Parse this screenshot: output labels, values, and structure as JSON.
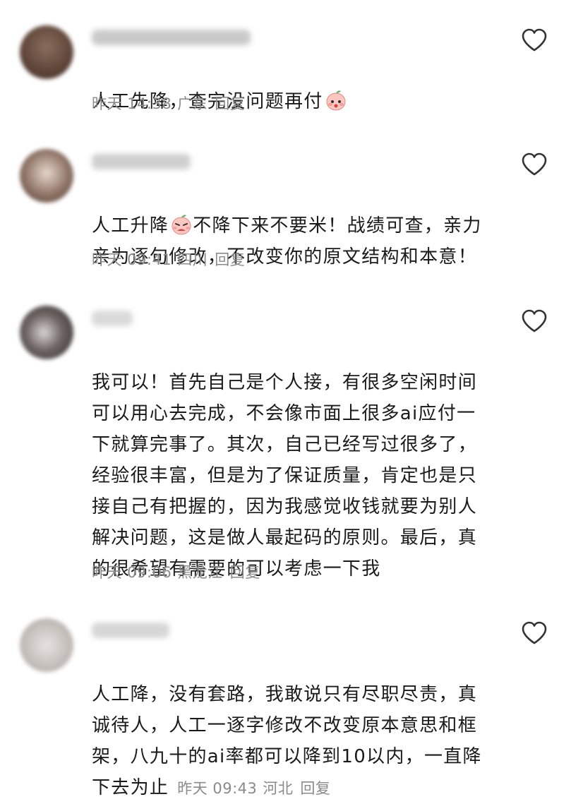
{
  "comments": [
    {
      "text": "人工先降，查完没问题再付",
      "emoji": "flushed-peach-emoji",
      "date": "昨天 14:38",
      "region": "广东",
      "reply": "回复",
      "avatar_color": "#6b5448"
    },
    {
      "text_a": "人工升降",
      "emoji": "angry-peach-emoji",
      "text_b": "不降下来不要米！战绩可查，亲力\n亲为逐句修改，不改变你的原文结构和本意！",
      "date": "昨天 09:41",
      "region": "四川",
      "reply": "回复",
      "avatar_color": "#8b7567"
    },
    {
      "text": "我可以！首先自己是个人接，有很多空闲时间\n可以用心去完成，不会像市面上很多ai应付一\n下就算完事了。其次，自己已经写过很多了，\n经验很丰富，但是为了保证质量，肯定也是只\n接自己有把握的，因为我感觉收钱就要为别人\n解决问题，这是做人最起码的原则。最后，真\n的很希望有需要的可以考虑一下我",
      "date": "昨天 09:06",
      "region": "黑龙江",
      "reply": "回复",
      "avatar_color": "#5a5452"
    },
    {
      "text": "人工降，没有套路，我敢说只有尽职尽责，真\n诚待人，人工一逐字修改不改变原本意思和框\n架，八九十的ai率都可以降到10以内，一直降\n下去为止",
      "date": "昨天 09:43",
      "region": "河北",
      "reply": "回复",
      "avatar_color": "#c9c4c0"
    }
  ],
  "colors": {
    "text": "#1a1a1a",
    "meta": "#8a8a8a",
    "heart_stroke": "#333333"
  }
}
